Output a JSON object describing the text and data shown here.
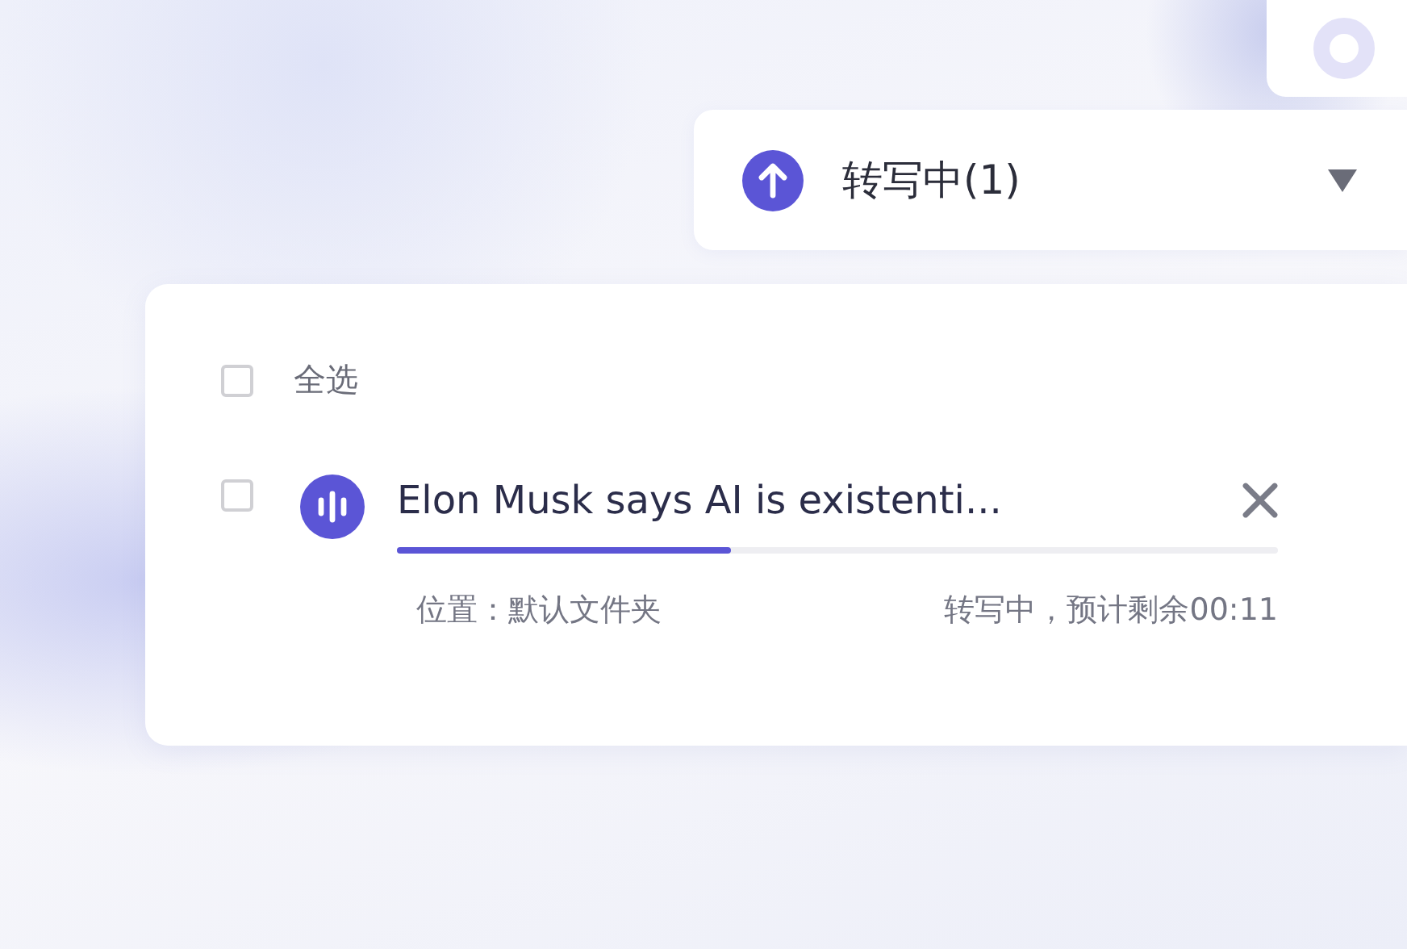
{
  "status_dropdown": {
    "label": "转写中(1)",
    "expanded": false
  },
  "panel": {
    "select_all": {
      "label": "全选",
      "checked": false
    },
    "files": [
      {
        "title": "Elon Musk says AI is existenti...",
        "checked": false,
        "level": 0.38,
        "location": "位置：默认文件夹",
        "status": "转写中，预计剩余00:11"
      }
    ]
  }
}
